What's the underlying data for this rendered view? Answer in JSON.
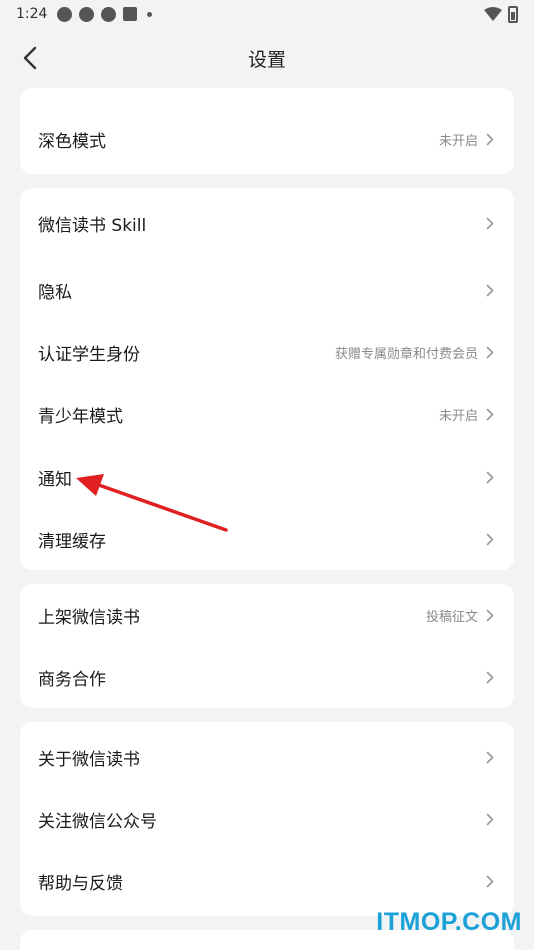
{
  "status_bar": {
    "time": "1:24"
  },
  "nav": {
    "title": "设置"
  },
  "sections": [
    {
      "rows": [
        {
          "label": "深色模式",
          "hint": "未开启"
        }
      ]
    },
    {
      "rows": [
        {
          "label": "微信读书 Skill",
          "hint": ""
        },
        {
          "label": "隐私",
          "hint": ""
        },
        {
          "label": "认证学生身份",
          "hint": "获赠专属勋章和付费会员"
        },
        {
          "label": "青少年模式",
          "hint": "未开启"
        },
        {
          "label": "通知",
          "hint": ""
        },
        {
          "label": "清理缓存",
          "hint": ""
        }
      ]
    },
    {
      "rows": [
        {
          "label": "上架微信读书",
          "hint": "投稿征文"
        },
        {
          "label": "商务合作",
          "hint": ""
        }
      ]
    },
    {
      "rows": [
        {
          "label": "关于微信读书",
          "hint": ""
        },
        {
          "label": "关注微信公众号",
          "hint": ""
        },
        {
          "label": "帮助与反馈",
          "hint": ""
        }
      ]
    }
  ],
  "annotation_arrow": {
    "color": "#e02020"
  },
  "watermark": {
    "text": "ITMOP.COM"
  }
}
